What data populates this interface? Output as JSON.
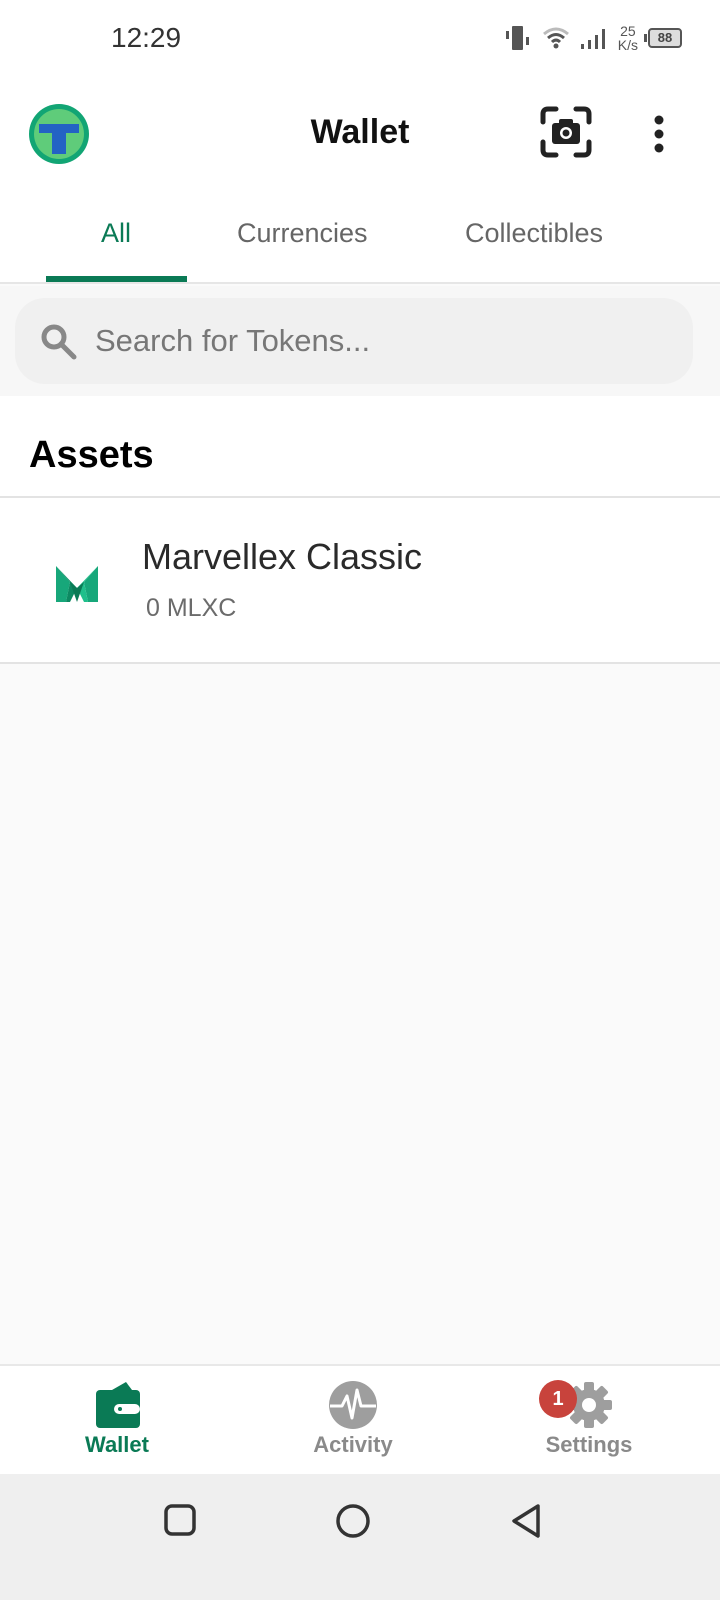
{
  "status_bar": {
    "time": "12:29",
    "network_speed_value": "25",
    "network_speed_unit": "K/s",
    "battery": "88"
  },
  "header": {
    "title": "Wallet",
    "scan_icon": "camera-scan-icon",
    "menu_icon": "more-vertical-icon"
  },
  "tabs": [
    {
      "label": "All",
      "active": true
    },
    {
      "label": "Currencies",
      "active": false
    },
    {
      "label": "Collectibles",
      "active": false
    }
  ],
  "search": {
    "placeholder": "Search for Tokens...",
    "value": ""
  },
  "assets": {
    "title": "Assets",
    "items": [
      {
        "name": "Marvellex Classic",
        "balance": "0 MLXC",
        "icon": "marvellex-logo"
      }
    ]
  },
  "bottom_nav": [
    {
      "label": "Wallet",
      "icon": "wallet-icon",
      "active": true
    },
    {
      "label": "Activity",
      "icon": "activity-icon",
      "active": false
    },
    {
      "label": "Settings",
      "icon": "gear-icon",
      "active": false,
      "badge": "1"
    }
  ],
  "colors": {
    "accent": "#0a7a55",
    "badge": "#c8433c",
    "inactive": "#8a8a8a"
  }
}
